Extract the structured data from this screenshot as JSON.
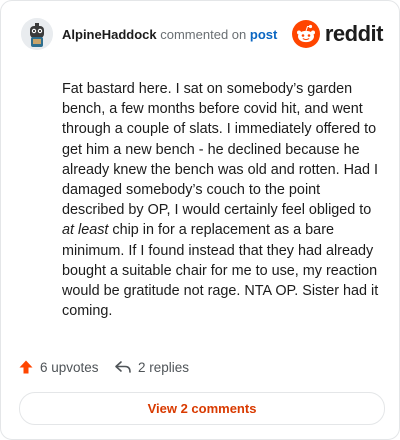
{
  "header": {
    "username": "AlpineHaddock",
    "commented_text": "commented on",
    "post_link": "post",
    "brand": "reddit"
  },
  "comment": {
    "text_before_em": "Fat bastard here. I sat on somebody’s garden bench, a few months before covid hit, and went through a couple of slats. I immediately offered to get him a new bench - he declined because he already knew the bench was old and rotten. Had I damaged somebody’s couch to the point described by OP, I would certainly feel obliged to ",
    "em_text": "at least",
    "text_after_em": " chip in for a replacement as a bare minimum. If I found instead that they had already bought a suitable chair for me to use, my reaction would be gratitude not rage. NTA OP. Sister had it coming."
  },
  "actions": {
    "upvotes": "6 upvotes",
    "replies": "2 replies"
  },
  "view_comments": "View 2 comments",
  "colors": {
    "reddit_orange": "#ff4500",
    "link_blue": "#0a66c2",
    "view_button_text": "#d93a00"
  },
  "icons": {
    "avatar": "snoo-avatar",
    "brand": "reddit-logo-icon",
    "upvote": "upvote-arrow-icon",
    "reply": "reply-arrow-icon"
  }
}
